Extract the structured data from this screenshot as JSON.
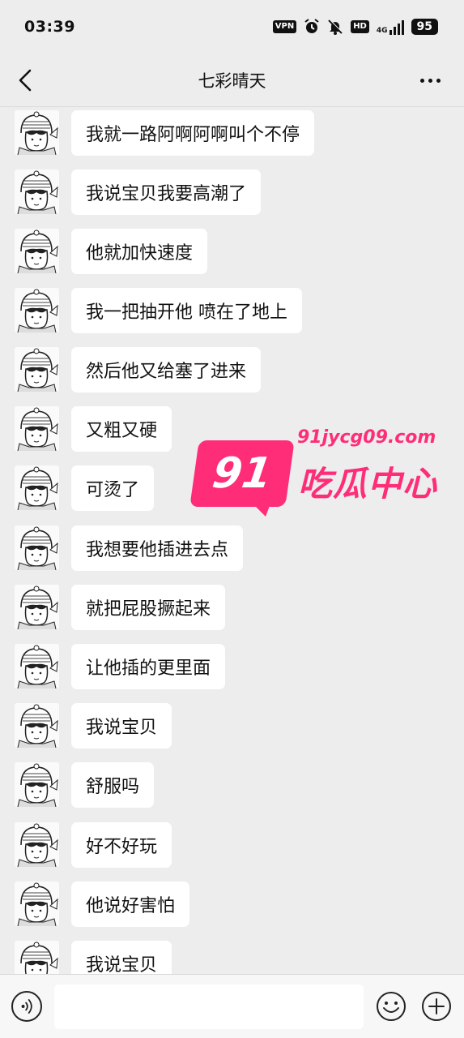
{
  "status_bar": {
    "time": "03:39",
    "vpn_label": "VPN",
    "hd_label": "HD",
    "network_label": "4G",
    "battery": "95"
  },
  "header": {
    "title": "七彩晴天"
  },
  "messages": [
    {
      "text": "我就一路阿啊阿啊叫个不停"
    },
    {
      "text": "我说宝贝我要高潮了"
    },
    {
      "text": "他就加快速度"
    },
    {
      "text": "我一把抽开他 喷在了地上"
    },
    {
      "text": "然后他又给塞了进来"
    },
    {
      "text": "又粗又硬"
    },
    {
      "text": "可烫了"
    },
    {
      "text": "我想要他插进去点"
    },
    {
      "text": "就把屁股撅起来"
    },
    {
      "text": "让他插的更里面"
    },
    {
      "text": "我说宝贝"
    },
    {
      "text": "舒服吗"
    },
    {
      "text": "好不好玩"
    },
    {
      "text": "他说好害怕"
    },
    {
      "text": "我说宝贝"
    }
  ],
  "watermark": {
    "badge": "91",
    "domain": "91jycg09.com",
    "text": "吃瓜中心"
  },
  "input_bar": {
    "placeholder": ""
  },
  "colors": {
    "background": "#ededed",
    "bubble": "#ffffff",
    "watermark": "#ff2d78"
  },
  "icons": [
    "back-arrow-icon",
    "more-dots-icon",
    "voice-icon",
    "emoji-icon",
    "plus-icon",
    "alarm-icon",
    "mute-bell-icon",
    "signal-icon"
  ]
}
